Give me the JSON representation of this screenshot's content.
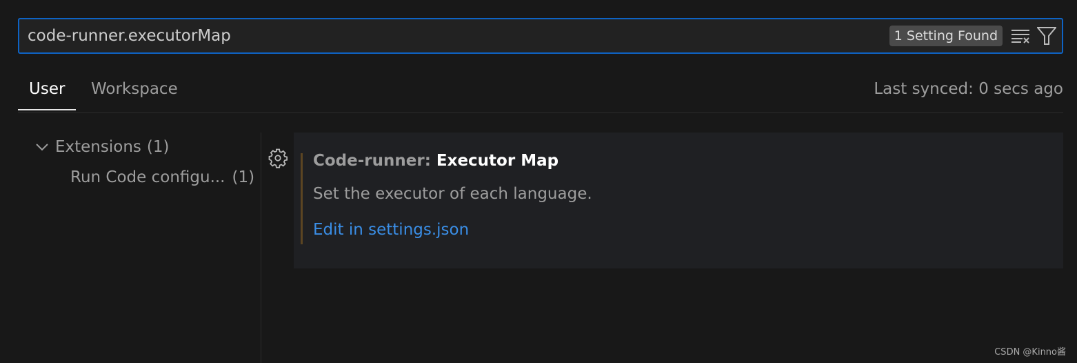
{
  "search": {
    "value": "code-runner.executorMap",
    "result_badge": "1 Setting Found",
    "icons": [
      "clear-filter-icon",
      "filter-icon"
    ],
    "border_color": "#0e63c4"
  },
  "tabs": [
    {
      "label": "User",
      "active": true
    },
    {
      "label": "Workspace",
      "active": false
    }
  ],
  "sync_status": "Last synced: 0 secs ago",
  "tree": {
    "group": "Extensions",
    "group_count": "(1)",
    "item": "Run Code configu...",
    "item_count": "(1)"
  },
  "setting": {
    "category": "Code-runner: ",
    "name": "Executor Map",
    "description": "Set the executor of each language.",
    "link": "Edit in settings.json",
    "link_color": "#3a8ee6"
  },
  "watermark": "CSDN @Kinno酱"
}
